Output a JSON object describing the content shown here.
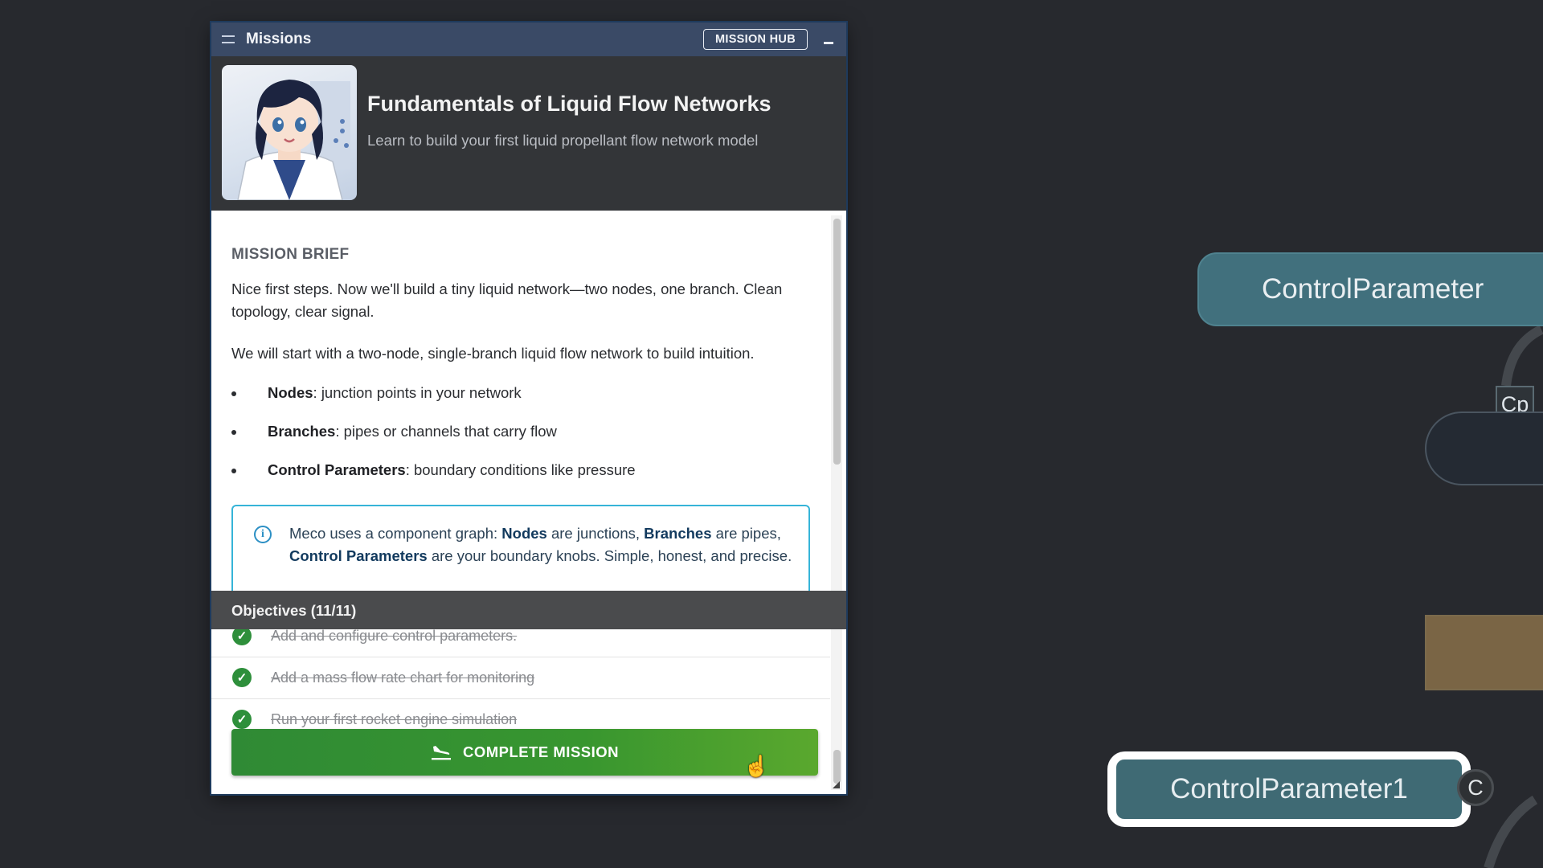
{
  "panel": {
    "title": "Missions",
    "hub_button": "MISSION HUB",
    "mission_title": "Fundamentals of Liquid Flow Networks",
    "mission_subtitle": "Learn to build your first liquid propellant flow network model",
    "brief_label": "MISSION BRIEF",
    "brief_p1": "Nice first steps. Now we'll build a tiny liquid network—two nodes, one branch. Clean topology, clear signal.",
    "brief_p2": "We will start with a two-node, single-branch liquid flow network to build intuition.",
    "bullets": [
      {
        "term": "Nodes",
        "desc": ": junction points in your network"
      },
      {
        "term": "Branches",
        "desc": ": pipes or channels that carry flow"
      },
      {
        "term": "Control Parameters",
        "desc": ": boundary conditions like pressure"
      }
    ],
    "info": {
      "t1": "Meco uses a component graph: ",
      "b1": "Nodes",
      "t2": " are junctions, ",
      "b2": "Branches",
      "t3": " are pipes, ",
      "b3": "Control Parameters",
      "t4": " are your boundary knobs. Simple, honest, and precise."
    },
    "objectives_header": "Objectives (11/11)",
    "objectives": [
      "Add and configure control parameters.",
      "Add a mass flow rate chart for monitoring",
      "Run your first rocket engine simulation"
    ],
    "complete_button": "COMPLETE MISSION"
  },
  "canvas": {
    "node_control_parameter": "ControlParameter",
    "badge_cp": "Cp",
    "node_control_parameter1": "ControlParameter1",
    "port_c": "C"
  },
  "colors": {
    "titlebar": "#3a4a66",
    "header": "#333538",
    "accent_info": "#36b4d8",
    "complete_green": "#2f8a35",
    "node_teal": "#41707d",
    "node_brown": "#7a6545"
  }
}
